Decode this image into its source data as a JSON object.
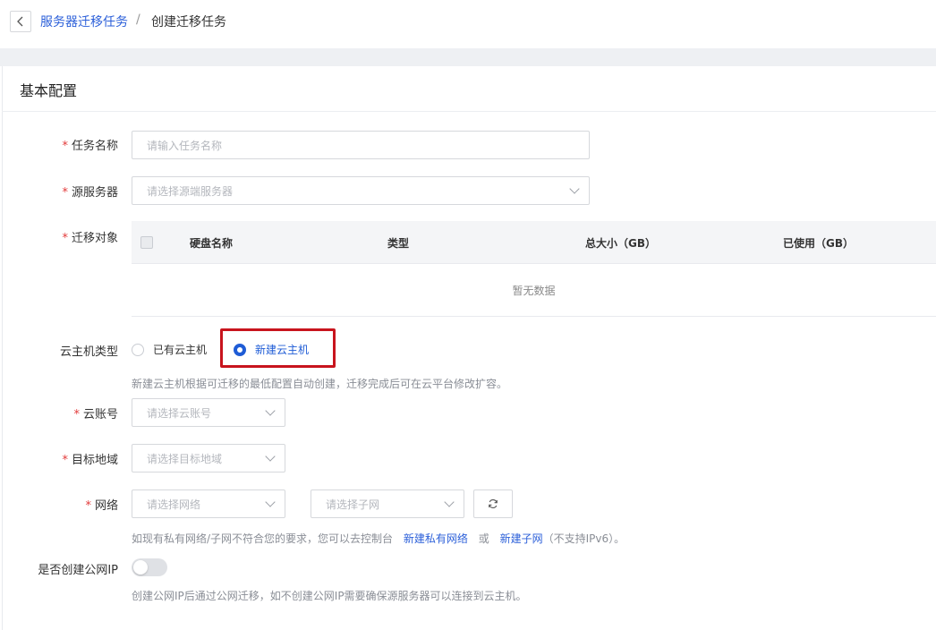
{
  "breadcrumb": {
    "parent": "服务器迁移任务",
    "separator": "/",
    "current": "创建迁移任务"
  },
  "section_title": "基本配置",
  "fields": {
    "task_name": {
      "label": "任务名称",
      "placeholder": "请输入任务名称"
    },
    "source_server": {
      "label": "源服务器",
      "placeholder": "请选择源端服务器"
    },
    "migration_target": {
      "label": "迁移对象"
    },
    "vm_type": {
      "label": "云主机类型",
      "options": [
        "已有云主机",
        "新建云主机"
      ],
      "selected": "新建云主机",
      "hint": "新建云主机根据可迁移的最低配置自动创建，迁移完成后可在云平台修改扩容。"
    },
    "cloud_account": {
      "label": "云账号",
      "placeholder": "请选择云账号"
    },
    "target_region": {
      "label": "目标地域",
      "placeholder": "请选择目标地域"
    },
    "network": {
      "label": "网络",
      "network_placeholder": "请选择网络",
      "subnet_placeholder": "请选择子网",
      "hint_prefix": "如现有私有网络/子网不符合您的要求，您可以去控制台",
      "link_vpc": "新建私有网络",
      "hint_or": "或",
      "link_subnet": "新建子网",
      "hint_suffix": "（不支持IPv6）。"
    },
    "public_ip": {
      "label": "是否创建公网IP",
      "enabled": false,
      "hint": "创建公网IP后通过公网迁移，如不创建公网IP需要确保源服务器可以连接到云主机。"
    }
  },
  "disk_table": {
    "columns": [
      "硬盘名称",
      "类型",
      "总大小（GB）",
      "已使用（GB）"
    ],
    "empty_text": "暂无数据"
  },
  "required_mark": "*",
  "colors": {
    "accent": "#1f5cd6",
    "link": "#2b5fd9",
    "required": "#e23a3a",
    "highlight": "#c8141d"
  }
}
